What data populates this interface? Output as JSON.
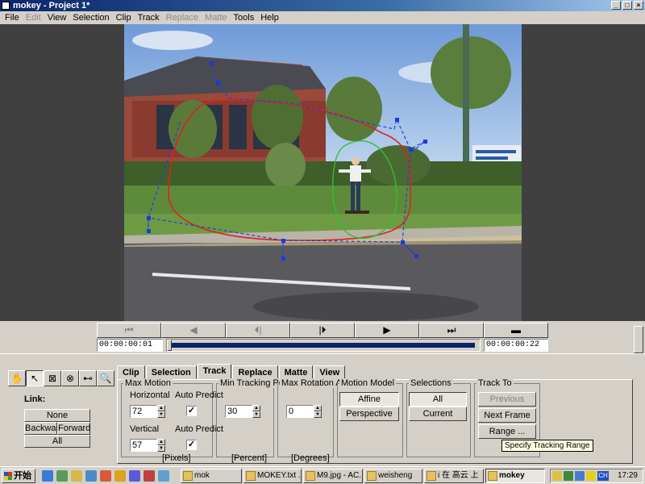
{
  "window": {
    "title": "mokey - Project 1*"
  },
  "menu": [
    "File",
    "Edit",
    "View",
    "Selection",
    "Clip",
    "Track",
    "Replace",
    "Matte",
    "Tools",
    "Help"
  ],
  "menu_disabled": [
    "Edit",
    "Replace",
    "Matte"
  ],
  "player": {
    "buttons": [
      "⏮",
      "◀",
      "⏴|",
      "|⏵",
      "▶",
      "⏭",
      "▬"
    ],
    "start_time": "00:00:00:01",
    "end_time": "00:00:00:22",
    "position": 0.0
  },
  "tools": {
    "icons": [
      "hand-icon",
      "pointer-icon",
      "transform-icon",
      "node-icon",
      "link-icon",
      "zoom-icon"
    ],
    "glyphs": [
      "✋",
      "↖",
      "⊠",
      "⊗",
      "⊷",
      "🔍"
    ]
  },
  "link": {
    "label": "Link:",
    "none": "None",
    "backward": "Backward",
    "forward": "Forward",
    "all": "All"
  },
  "tabs": [
    "Clip",
    "Selection",
    "Track",
    "Replace",
    "Matte",
    "View"
  ],
  "active_tab": "Track",
  "track": {
    "max_motion": {
      "title": "Max Motion",
      "horizontal_label": "Horizontal",
      "horizontal_value": "72",
      "vertical_label": "Vertical",
      "vertical_value": "57",
      "auto_predict_label": "Auto Predict",
      "unit": "[Pixels]"
    },
    "min_tracking": {
      "title": "Min Tracking Poin",
      "value": "30",
      "unit": "[Percent]"
    },
    "max_rotation": {
      "title": "Max Rotation Ang",
      "value": "0",
      "unit": "[Degrees]"
    },
    "motion_model": {
      "title": "Motion Model",
      "affine": "Affine",
      "perspective": "Perspective"
    },
    "selections": {
      "title": "Selections",
      "all": "All",
      "current": "Current"
    },
    "track_to": {
      "title": "Track To",
      "previous": "Previous Frame",
      "next": "Next Frame",
      "range": "Range ..."
    }
  },
  "tooltip": "Specify Tracking Range",
  "taskbar": {
    "start": "开始",
    "tasks": [
      "mok",
      "MOKEY.txt ...",
      "M9.jpg - AC...",
      "weisheng",
      "i 在 高云 上",
      "mokey"
    ],
    "tray_icons": [
      "CH"
    ],
    "clock": "17:29"
  }
}
